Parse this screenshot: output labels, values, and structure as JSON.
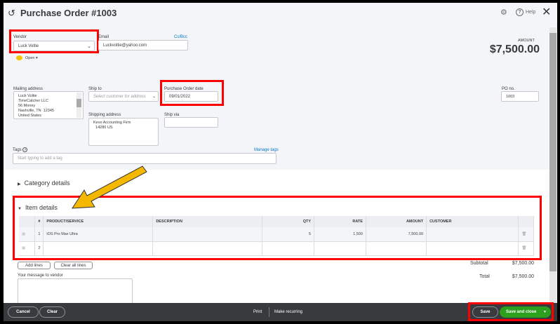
{
  "header": {
    "title": "Purchase Order #1003",
    "help": "Help"
  },
  "vendor": {
    "label": "Vendor",
    "value": "Luck Voltie",
    "status": "Open"
  },
  "email": {
    "label": "Email",
    "value": "Luckvoltie@yahoo.com",
    "cc_bcc": "Cc/Bcc"
  },
  "amount": {
    "label": "AMOUNT",
    "value": "$7,500.00"
  },
  "mailing": {
    "label": "Mailing address",
    "lines": "Luck Voltie\nTimeCatcher LLC\n56 Money\nNashville, TN  12345\nUnited States"
  },
  "ship_to": {
    "label": "Ship to",
    "placeholder": "Select customer for address"
  },
  "po_date": {
    "label": "Purchase Order date",
    "value": "09/01/2022"
  },
  "shipping": {
    "label": "Shipping address",
    "lines": "Kevo Accounting Firm\n  14280 US"
  },
  "ship_via": {
    "label": "Ship via",
    "value": ""
  },
  "po_no": {
    "label": "PO no.",
    "value": "1003"
  },
  "tags": {
    "label": "Tags",
    "manage": "Manage tags",
    "placeholder": "Start typing to add a tag"
  },
  "category": {
    "label": "Category details"
  },
  "items": {
    "label": "Item details",
    "columns": [
      "#",
      "PRODUCT/SERVICE",
      "DESCRIPTION",
      "QTY",
      "RATE",
      "AMOUNT",
      "CUSTOMER"
    ],
    "rows": [
      {
        "num": "1",
        "product": "iOS Pro Max Ultra",
        "description": "",
        "qty": "5",
        "rate": "1,500",
        "amount": "7,500.00",
        "customer": ""
      },
      {
        "num": "2",
        "product": "",
        "description": "",
        "qty": "",
        "rate": "",
        "amount": "",
        "customer": ""
      }
    ]
  },
  "actions": {
    "add_lines": "Add lines",
    "clear_all": "Clear all lines"
  },
  "message": {
    "label": "Your message to vendor"
  },
  "totals": {
    "subtotal_label": "Subtotal",
    "subtotal": "$7,500.00",
    "total_label": "Total",
    "total": "$7,500.00"
  },
  "footer": {
    "cancel": "Cancel",
    "clear": "Clear",
    "print": "Print",
    "recurring": "Make recurring",
    "save": "Save",
    "save_close": "Save and close"
  },
  "colors": {
    "accent_green": "#2ca01c",
    "highlight": "#ff0000",
    "arrow": "#f5b800"
  }
}
